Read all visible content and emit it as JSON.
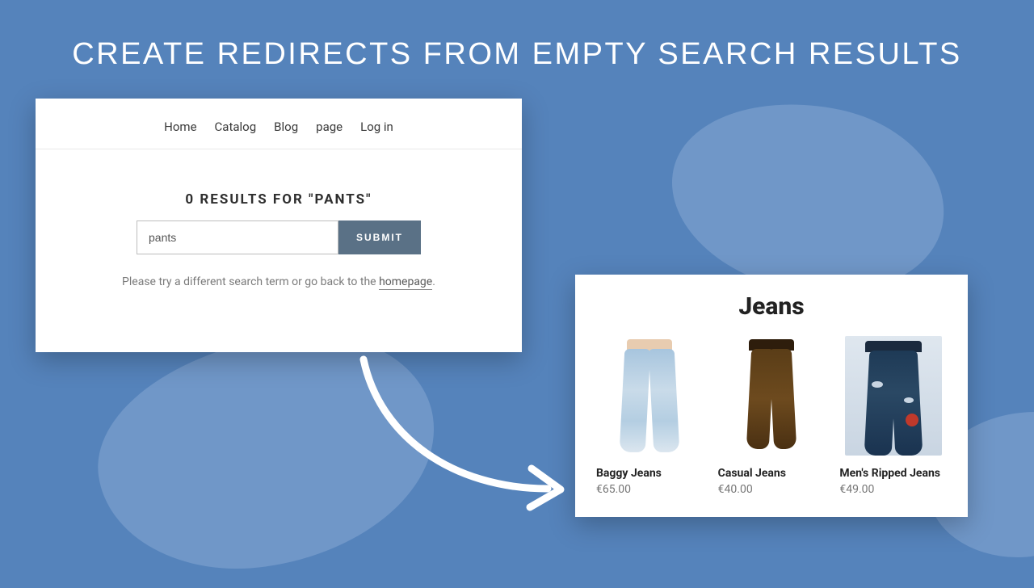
{
  "headline": "CREATE REDIRECTS FROM EMPTY SEARCH RESULTS",
  "searchPanel": {
    "nav": [
      "Home",
      "Catalog",
      "Blog",
      "page",
      "Log in"
    ],
    "resultsTitle": "0 RESULTS FOR \"PANTS\"",
    "searchValue": "pants",
    "submitLabel": "SUBMIT",
    "hintPrefix": "Please try a different search term or go back to the ",
    "hintLinkText": "homepage",
    "hintSuffix": "."
  },
  "productsPanel": {
    "title": "Jeans",
    "products": [
      {
        "name": "Baggy Jeans",
        "price": "€65.00"
      },
      {
        "name": "Casual Jeans",
        "price": "€40.00"
      },
      {
        "name": "Men's Ripped Jeans",
        "price": "€49.00"
      }
    ]
  }
}
